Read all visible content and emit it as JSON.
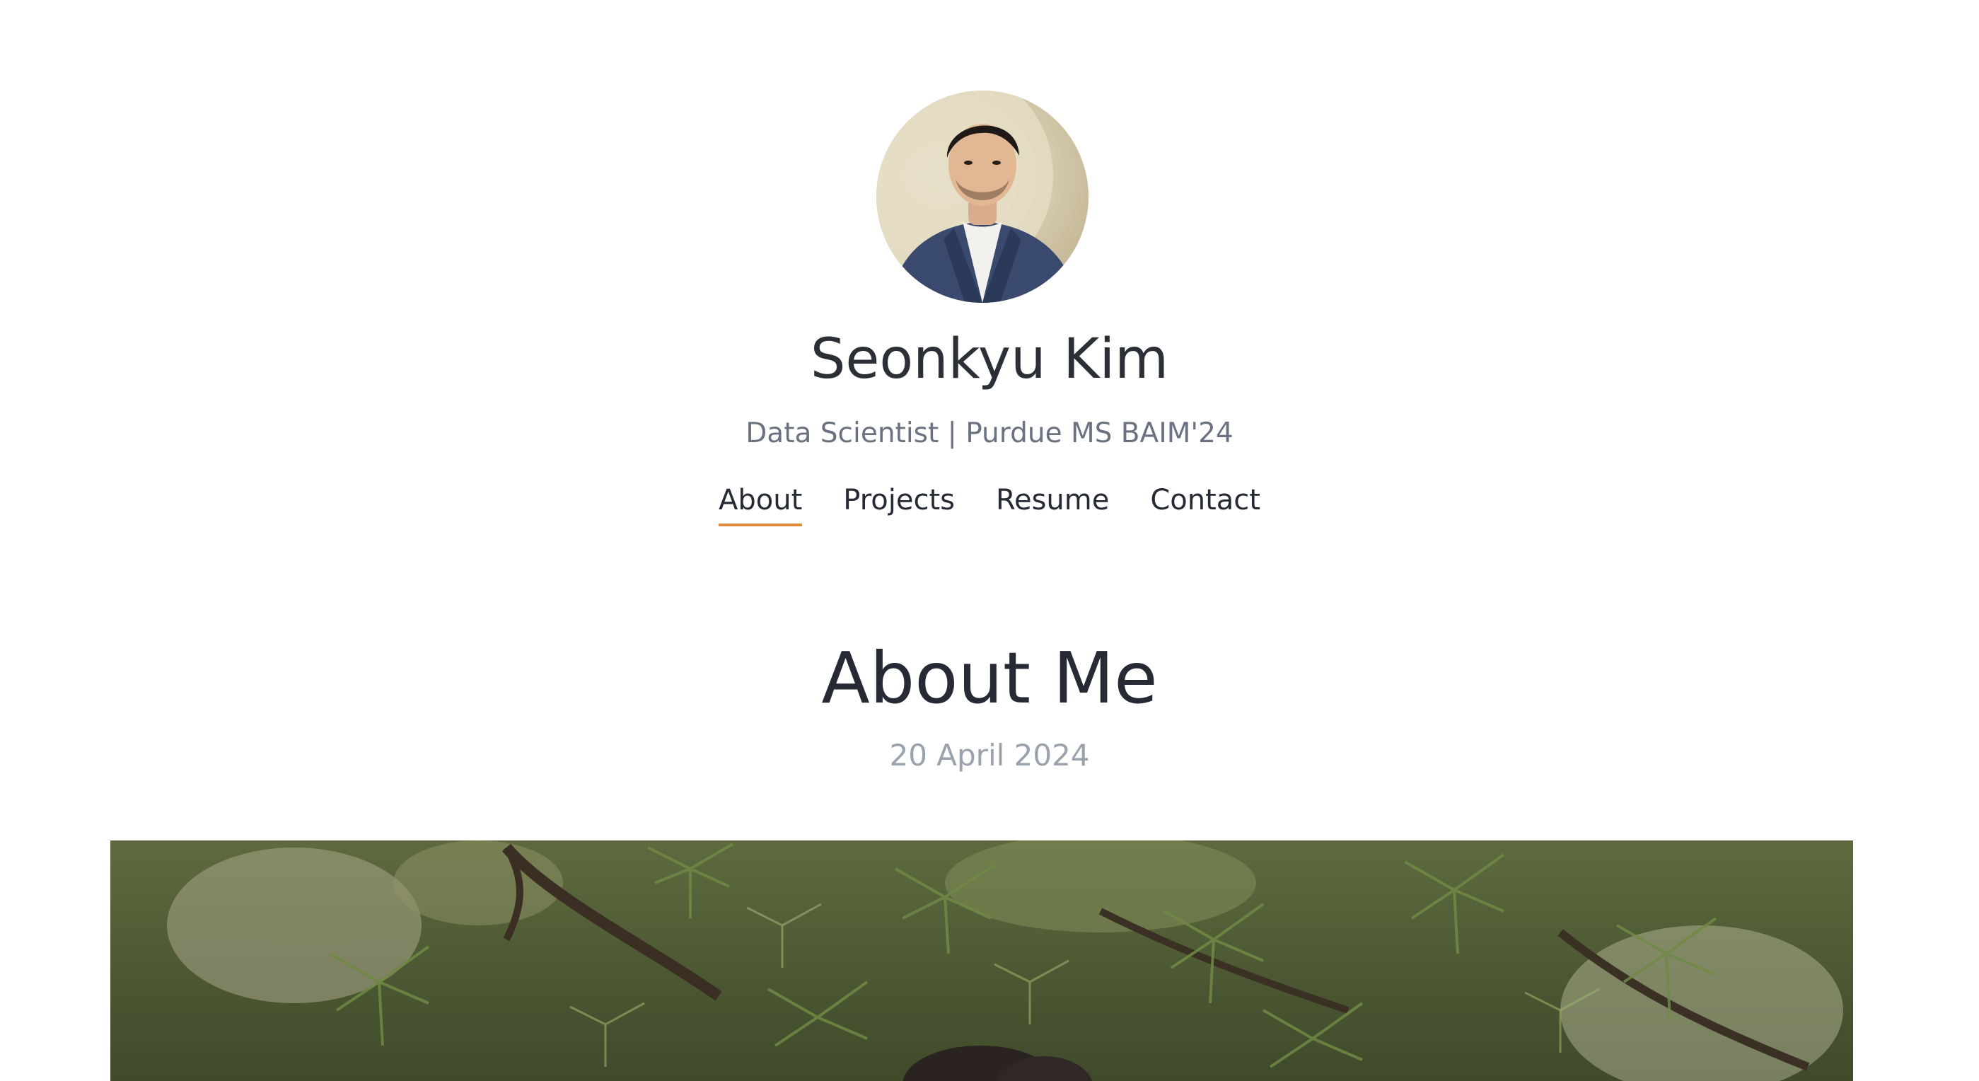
{
  "site": {
    "name": "Seonkyu Kim",
    "tagline": "Data Scientist | Purdue MS BAIM'24",
    "accent_color": "#e08a3b"
  },
  "nav": {
    "items": [
      {
        "label": "About",
        "active": true
      },
      {
        "label": "Projects",
        "active": false
      },
      {
        "label": "Resume",
        "active": false
      },
      {
        "label": "Contact",
        "active": false
      }
    ]
  },
  "post": {
    "title": "About Me",
    "date": "20 April 2024"
  },
  "images": {
    "avatar": "profile-photo",
    "hero": "pine-tree-photo"
  }
}
